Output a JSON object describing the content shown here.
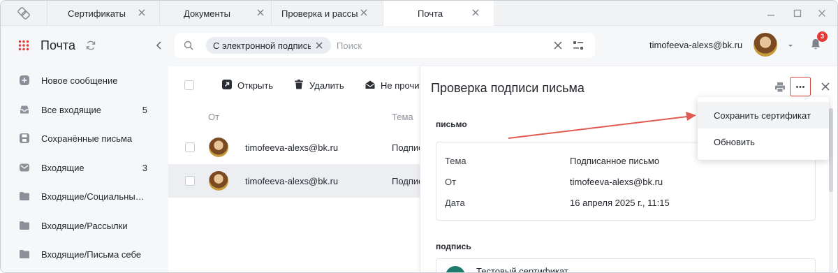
{
  "tabs": [
    {
      "label": "Сертификаты",
      "active": false
    },
    {
      "label": "Документы",
      "active": false
    },
    {
      "label": "Проверка и рассылка",
      "active": false
    },
    {
      "label": "Почта",
      "active": true
    }
  ],
  "header": {
    "app_title": "Почта",
    "search_chip": "С электронной подписью",
    "search_placeholder": "Поиск",
    "user_email": "timofeeva-alexs@bk.ru",
    "notifications_count": "3"
  },
  "sidebar": {
    "items": [
      {
        "label": "Новое сообщение",
        "icon": "plus-square-icon",
        "count": ""
      },
      {
        "label": "Все входящие",
        "icon": "inbox-icon",
        "count": "5"
      },
      {
        "label": "Сохранённые письма",
        "icon": "save-icon",
        "count": ""
      },
      {
        "label": "Входящие",
        "icon": "mail-icon",
        "count": "3"
      },
      {
        "label": "Входящие/Социальные сети",
        "icon": "folder-icon",
        "count": ""
      },
      {
        "label": "Входящие/Рассылки",
        "icon": "folder-icon",
        "count": ""
      },
      {
        "label": "Входящие/Письма себе",
        "icon": "folder-icon",
        "count": ""
      }
    ]
  },
  "list": {
    "toolbar": {
      "open_label": "Открыть",
      "delete_label": "Удалить",
      "unread_label": "Не прочитано"
    },
    "columns": {
      "from": "От",
      "subject": "Тема"
    },
    "rows": [
      {
        "from": "timofeeva-alexs@bk.ru",
        "subject": "Подписанное письмо",
        "selected": false
      },
      {
        "from": "timofeeva-alexs@bk.ru",
        "subject": "Подписанное письмо",
        "selected": true
      }
    ]
  },
  "detail": {
    "title": "Проверка подписи письма",
    "letter_section": "письмо",
    "fields": [
      {
        "key": "Тема",
        "value": "Подписанное письмо"
      },
      {
        "key": "От",
        "value": "timofeeva-alexs@bk.ru"
      },
      {
        "key": "Дата",
        "value": "16 апреля 2025 г., 11:15"
      }
    ],
    "signature_section": "подпись",
    "certificate_name": "Тестовый сертификат"
  },
  "menu": {
    "items": [
      {
        "label": "Сохранить сертификат",
        "hover": true
      },
      {
        "label": "Обновить",
        "hover": false
      }
    ]
  },
  "colors": {
    "accent_red": "#d9453f",
    "badge_red": "#e53935",
    "sidebar_bg": "#f6f7f9",
    "selected_row": "#eceef2"
  }
}
